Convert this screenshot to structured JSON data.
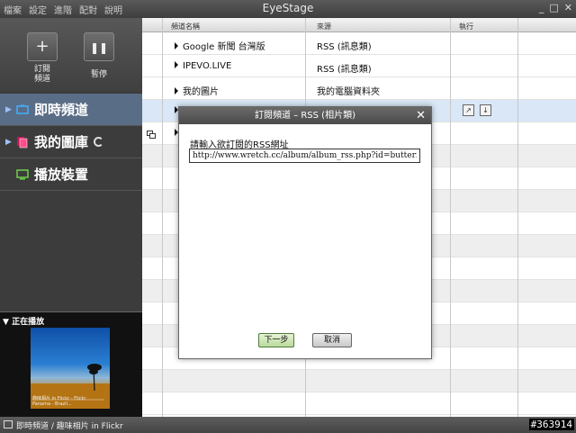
{
  "app": {
    "title": "EyeStage",
    "menu": [
      "檔案",
      "設定",
      "進階",
      "配對",
      "說明"
    ],
    "window_controls": {
      "minimize": "_",
      "maximize": "□",
      "close": "✕"
    }
  },
  "sidebar": {
    "subscribe_label": "訂閱\n頻道",
    "pause_label": "暫停",
    "nav_items": [
      {
        "label": "即時頻道",
        "icon": "tv-icon"
      },
      {
        "label": "我的圖庫",
        "icon": "photo-stack-icon"
      },
      {
        "label": "播放裝置",
        "icon": "monitor-icon"
      }
    ],
    "now_playing": {
      "header": "正在播放",
      "caption": "趣味相片 in Flickr - Flickr\nPanama - Brazil..."
    }
  },
  "table": {
    "headers": [
      "頻道名稱",
      "來源",
      "執行"
    ],
    "rows": [
      {
        "name": "Google 新聞 台灣版",
        "source": "RSS (訊息類)"
      },
      {
        "name": "IPEVO.LIVE",
        "source": "RSS (訊息類)"
      },
      {
        "name": "我的圖片",
        "source": "我的電腦資料夾"
      }
    ]
  },
  "dialog": {
    "title": "訂閱頻道 – RSS (相片類)",
    "close": "✕",
    "prompt": "請輸入欲訂閱的RSS網址",
    "url_value": "http://www.wretch.cc/album/album_rss.php?id=butterfly718",
    "next_label": "下一步",
    "cancel_label": "取消"
  },
  "statusbar": {
    "text": "即時頻道 / 趣味相片 in Flickr",
    "watermark": "#363914"
  }
}
